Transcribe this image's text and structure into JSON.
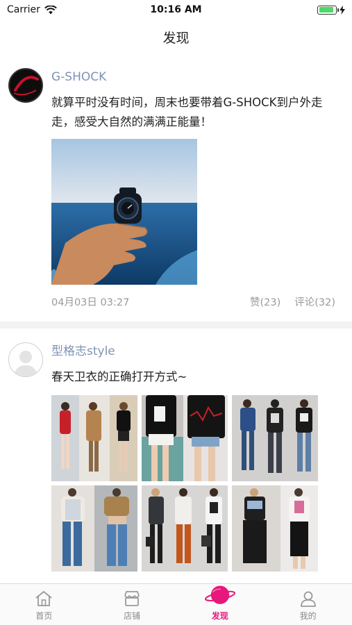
{
  "status_bar": {
    "carrier": "Carrier",
    "time": "10:16 AM",
    "battery_level": 0.9
  },
  "nav": {
    "title": "发现"
  },
  "posts": [
    {
      "author": "G-SHOCK",
      "avatar_text": "G-SHOCK",
      "content": "就算平时没有时间，周末也要带着G-SHOCK到户外走走，感受大自然的满满正能量！",
      "date": "04月03日 03:27",
      "like_label": "赞(23)",
      "comment_label": "评论(32)"
    },
    {
      "author": "型格志style",
      "content": "春天卫衣的正确打开方式~"
    }
  ],
  "tabs": [
    {
      "label": "首页",
      "icon": "home-icon"
    },
    {
      "label": "店铺",
      "icon": "store-icon"
    },
    {
      "label": "发现",
      "icon": "planet-icon"
    },
    {
      "label": "我的",
      "icon": "profile-icon"
    }
  ],
  "colors": {
    "accent": "#e8177c",
    "author": "#7f93b5",
    "meta": "#999999"
  }
}
